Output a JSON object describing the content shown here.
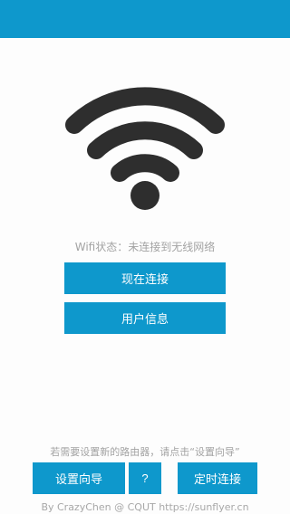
{
  "colors": {
    "accent": "#0e98cc",
    "wifi_icon": "#2e2e2e",
    "muted_text": "#a3a3a3",
    "background": "#fdfdfd"
  },
  "icons": {
    "wifi": "wifi-icon"
  },
  "status": {
    "text": "Wifi状态：未连接到无线网络"
  },
  "actions": {
    "connect_label": "现在连接",
    "user_info_label": "用户信息"
  },
  "hint": {
    "text": "若需要设置新的路由器，请点击“设置向导”"
  },
  "bottom_actions": {
    "wizard_label": "设置向导",
    "help_label": "?",
    "timer_label": "定时连接"
  },
  "footer": {
    "text": "By CrazyChen @ CQUT https://sunflyer.cn"
  }
}
